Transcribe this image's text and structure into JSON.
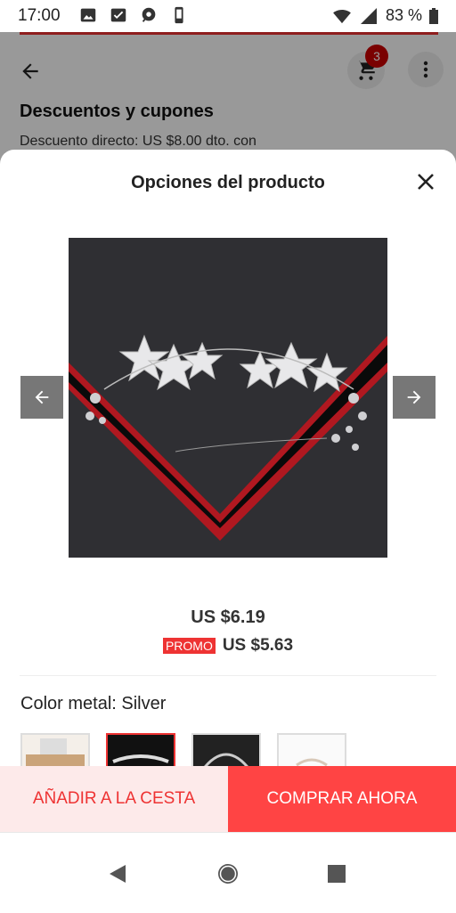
{
  "status_bar": {
    "time": "17:00",
    "battery": "83 %",
    "icons": [
      "image-icon",
      "check-photo-icon",
      "chat-icon",
      "phone-icon",
      "wifi-icon",
      "signal-icon",
      "battery-icon"
    ]
  },
  "background_page": {
    "cart_count": "3",
    "section_title": "Descuentos y cupones",
    "section_subtitle": "Descuento directo: US $8.00 dto. con"
  },
  "sheet": {
    "title": "Opciones del producto",
    "price": "US $6.19",
    "promo_label": "PROMO",
    "promo_price": "US $5.63",
    "color_label": "Color metal: Silver",
    "thumbnails": [
      "thumb-1",
      "thumb-2",
      "thumb-3",
      "thumb-4"
    ],
    "selected_thumbnail": 2
  },
  "actions": {
    "add_to_cart": "AÑADIR A LA CESTA",
    "buy_now": "COMPRAR AHORA"
  },
  "colors": {
    "accent": "#ee3333",
    "add_cart_bg": "#fdeaea",
    "buy_bg": "#ff4444"
  }
}
